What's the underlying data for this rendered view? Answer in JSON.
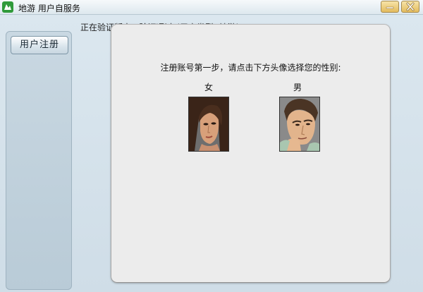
{
  "titlebar": {
    "title": "地游  用户自服务",
    "logo_icon": "app-logo-icon",
    "minimize_icon": "minimize-icon",
    "close_icon": "close-icon"
  },
  "sidebar": {
    "items": [
      {
        "label": "用户注册"
      }
    ]
  },
  "status": {
    "text": "正在验证版本...验证通过!(用户类型: 地游)"
  },
  "dialog": {
    "prompt": "注册账号第一步，请点击下方头像选择您的性别:",
    "options": [
      {
        "label": "女",
        "icon": "female-avatar-icon"
      },
      {
        "label": "男",
        "icon": "male-avatar-icon"
      }
    ]
  },
  "colors": {
    "window_bg": "#d9e6ee",
    "dialog_bg": "#ececec",
    "title_button": "#e3bb5e",
    "logo_green": "#2f9a3a"
  }
}
